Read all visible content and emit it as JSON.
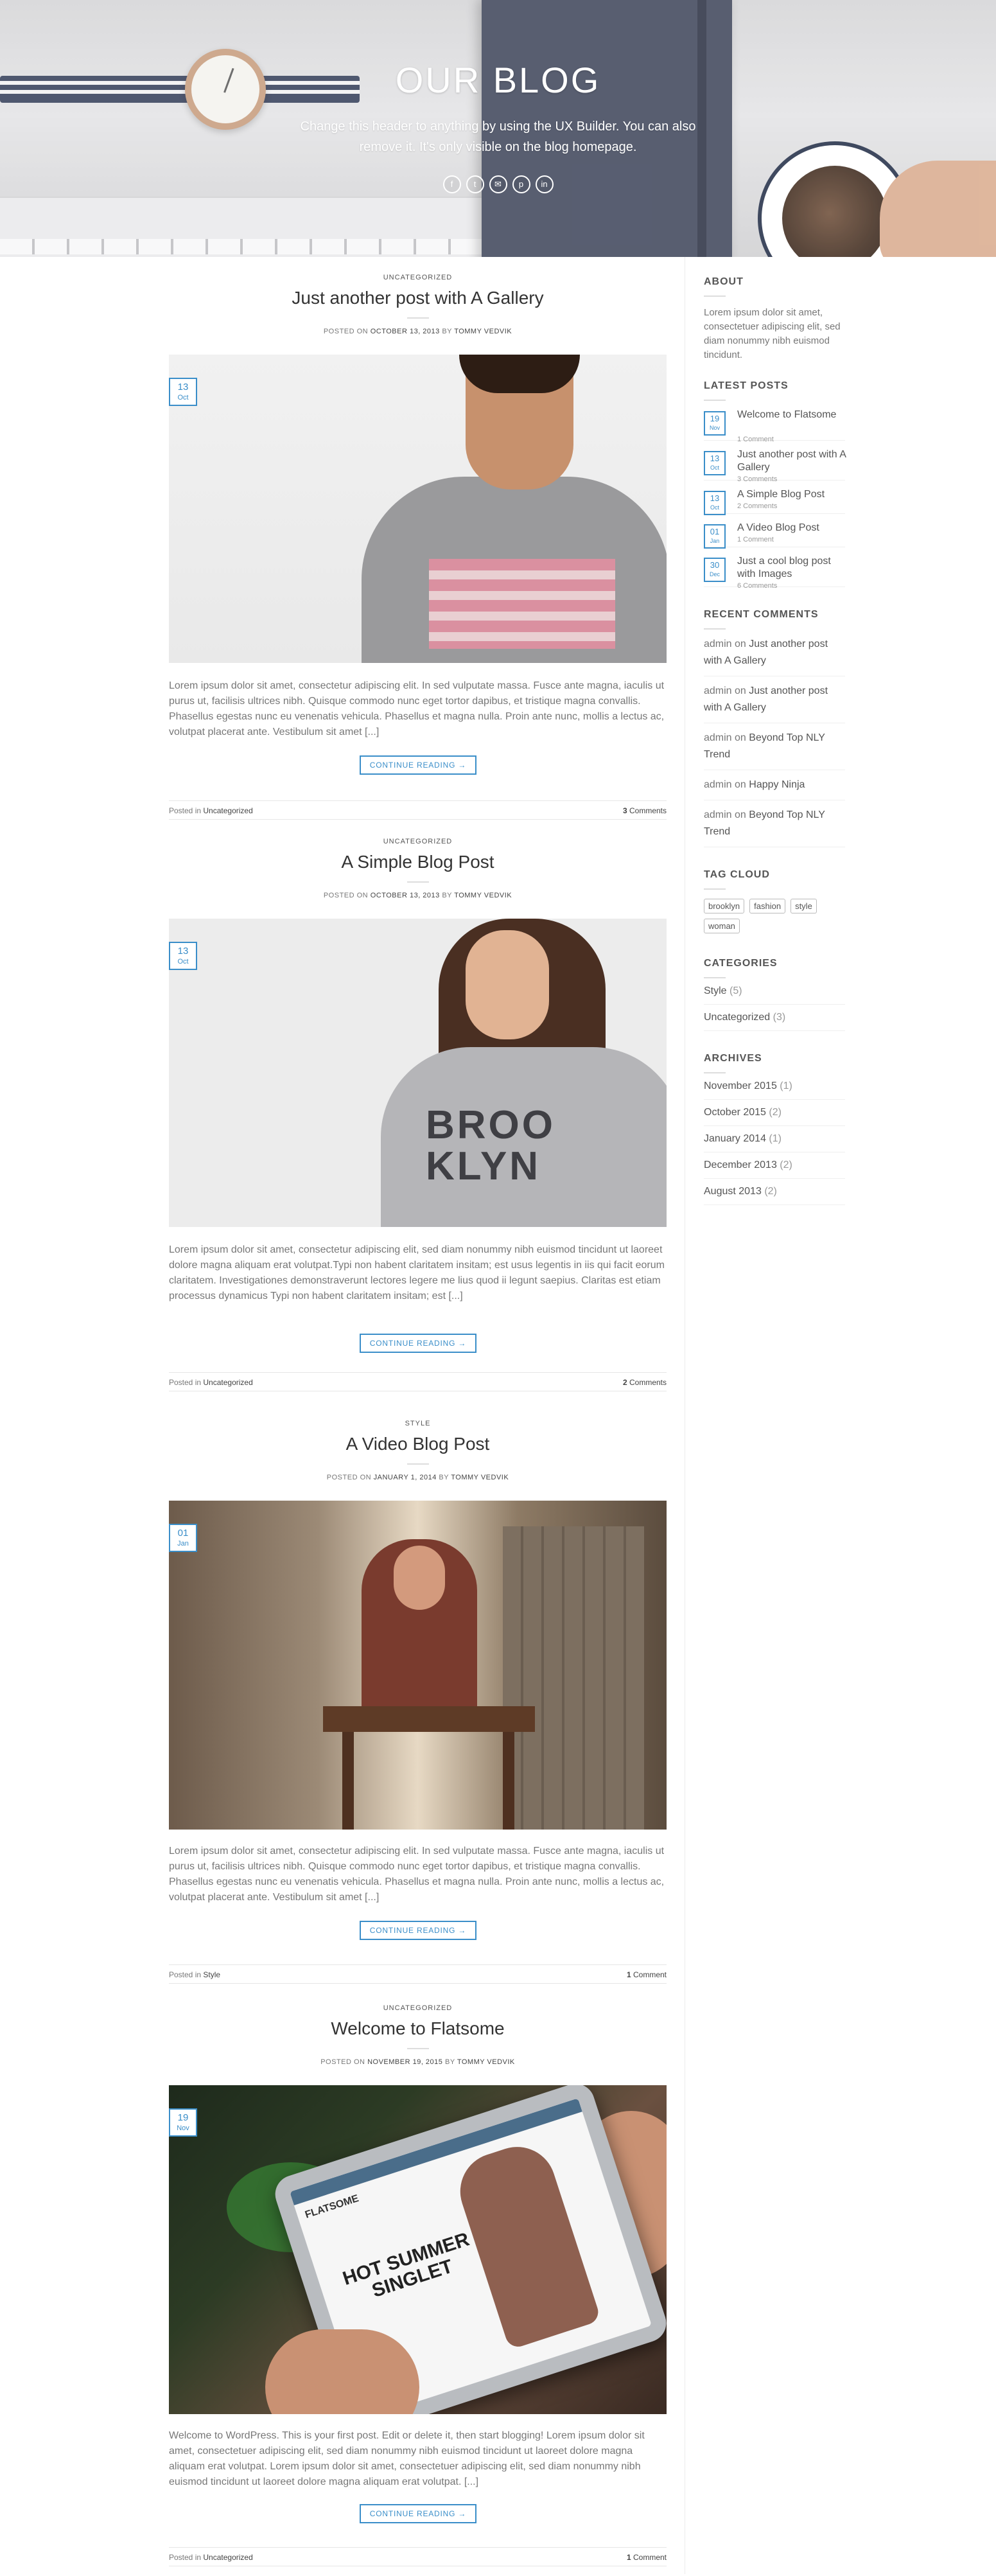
{
  "hero": {
    "title": "OUR BLOG",
    "description": "Change this header to anything by using the UX Builder. You can also remove it. It's only visible on the blog homepage.",
    "social_icons": [
      "facebook-icon",
      "twitter-icon",
      "email-icon",
      "pinterest-icon",
      "linkedin-icon"
    ]
  },
  "posts": [
    {
      "category": "UNCATEGORIZED",
      "title": "Just another post with A Gallery",
      "meta_prefix": "POSTED ON",
      "date": "OCTOBER 13, 2013",
      "meta_by": "BY",
      "author": "TOMMY VEDVIK",
      "badge_day": "13",
      "badge_month": "Oct",
      "excerpt": "Lorem ipsum dolor sit amet, consectetur adipiscing elit. In sed vulputate massa. Fusce ante magna, iaculis ut purus ut, facilisis ultrices nibh. Quisque commodo nunc eget tortor dapibus, et tristique magna convallis. Phasellus egestas nunc eu venenatis vehicula. Phasellus et magna nulla. Proin ante nunc, mollis a lectus ac, volutpat placerat ante. Vestibulum sit amet [...]",
      "more_label": "CONTINUE READING →",
      "posted_in_label": "Posted in",
      "posted_in": "Uncategorized",
      "comments_count": "3",
      "comments_label": "Comments"
    },
    {
      "category": "UNCATEGORIZED",
      "title": "A Simple Blog Post",
      "meta_prefix": "POSTED ON",
      "date": "OCTOBER 13, 2013",
      "meta_by": "BY",
      "author": "TOMMY VEDVIK",
      "badge_day": "13",
      "badge_month": "Oct",
      "image_text": "BROO\nKLYN",
      "excerpt": "Lorem ipsum dolor sit amet, consectetur adipiscing elit, sed diam nonummy nibh euismod tincidunt ut laoreet dolore magna aliquam erat volutpat.Typi non habent claritatem insitam; est usus legentis in iis qui facit eorum claritatem. Investigationes demonstraverunt lectores legere me lius quod ii legunt saepius. Claritas est etiam processus dynamicus Typi non habent claritatem insitam; est [...]",
      "more_label": "CONTINUE READING →",
      "posted_in_label": "Posted in",
      "posted_in": "Uncategorized",
      "comments_count": "2",
      "comments_label": "Comments"
    },
    {
      "category": "STYLE",
      "title": "A Video Blog Post",
      "meta_prefix": "POSTED ON",
      "date": "JANUARY 1, 2014",
      "meta_by": "BY",
      "author": "TOMMY VEDVIK",
      "badge_day": "01",
      "badge_month": "Jan",
      "excerpt": "Lorem ipsum dolor sit amet, consectetur adipiscing elit. In sed vulputate massa. Fusce ante magna, iaculis ut purus ut, facilisis ultrices nibh. Quisque commodo nunc eget tortor dapibus, et tristique magna convallis. Phasellus egestas nunc eu venenatis vehicula. Phasellus et magna nulla. Proin ante nunc, mollis a lectus ac, volutpat placerat ante. Vestibulum sit amet [...]",
      "more_label": "CONTINUE READING →",
      "posted_in_label": "Posted in",
      "posted_in": "Style",
      "comments_count": "1",
      "comments_label": "Comment"
    },
    {
      "category": "UNCATEGORIZED",
      "title": "Welcome to Flatsome",
      "meta_prefix": "POSTED ON",
      "date": "NOVEMBER 19, 2015",
      "meta_by": "BY",
      "author": "TOMMY VEDVIK",
      "badge_day": "19",
      "badge_month": "Nov",
      "image_brand": "FLATSOME",
      "image_headline": "HOT SUMMER SINGLET",
      "excerpt": "Welcome to WordPress. This is your first post. Edit or delete it, then start blogging! Lorem ipsum dolor sit amet, consectetuer adipiscing elit, sed diam nonummy nibh euismod tincidunt ut laoreet dolore magna aliquam erat volutpat. Lorem ipsum dolor sit amet, consectetuer adipiscing elit, sed diam nonummy nibh euismod tincidunt ut laoreet dolore magna aliquam erat volutpat. [...]",
      "more_label": "CONTINUE READING →",
      "posted_in_label": "Posted in",
      "posted_in": "Uncategorized",
      "comments_count": "1",
      "comments_label": "Comment"
    }
  ],
  "sidebar": {
    "about_title": "ABOUT",
    "about_text": "Lorem ipsum dolor sit amet, consectetuer adipiscing elit, sed diam nonummy nibh euismod tincidunt.",
    "latest_title": "LATEST POSTS",
    "latest": [
      {
        "day": "19",
        "month": "Nov",
        "title": "Welcome to Flatsome",
        "comments": "1 Comment"
      },
      {
        "day": "13",
        "month": "Oct",
        "title": "Just another post with A Gallery",
        "comments": "3 Comments"
      },
      {
        "day": "13",
        "month": "Oct",
        "title": "A Simple Blog Post",
        "comments": "2 Comments"
      },
      {
        "day": "01",
        "month": "Jan",
        "title": "A Video Blog Post",
        "comments": "1 Comment"
      },
      {
        "day": "30",
        "month": "Dec",
        "title": "Just a cool blog post with Images",
        "comments": "6 Comments"
      }
    ],
    "recent_comments_title": "RECENT COMMENTS",
    "recent_comments": [
      {
        "who": "admin",
        "on": "on",
        "post": "Just another post with A Gallery"
      },
      {
        "who": "admin",
        "on": "on",
        "post": "Just another post with A Gallery"
      },
      {
        "who": "admin",
        "on": "on",
        "post": "Beyond Top NLY Trend"
      },
      {
        "who": "admin",
        "on": "on",
        "post": "Happy Ninja"
      },
      {
        "who": "admin",
        "on": "on",
        "post": "Beyond Top NLY Trend"
      }
    ],
    "tag_cloud_title": "TAG CLOUD",
    "tags": [
      "brooklyn",
      "fashion",
      "style",
      "woman"
    ],
    "categories_title": "CATEGORIES",
    "categories": [
      {
        "name": "Style",
        "count": "(5)"
      },
      {
        "name": "Uncategorized",
        "count": "(3)"
      }
    ],
    "archives_title": "ARCHIVES",
    "archives": [
      {
        "name": "November 2015",
        "count": "(1)"
      },
      {
        "name": "October 2015",
        "count": "(2)"
      },
      {
        "name": "January 2014",
        "count": "(1)"
      },
      {
        "name": "December 2013",
        "count": "(2)"
      },
      {
        "name": "August 2013",
        "count": "(2)"
      }
    ]
  },
  "colors": {
    "accent": "#3a8ec9",
    "text": "#777777",
    "heading": "#333333"
  }
}
